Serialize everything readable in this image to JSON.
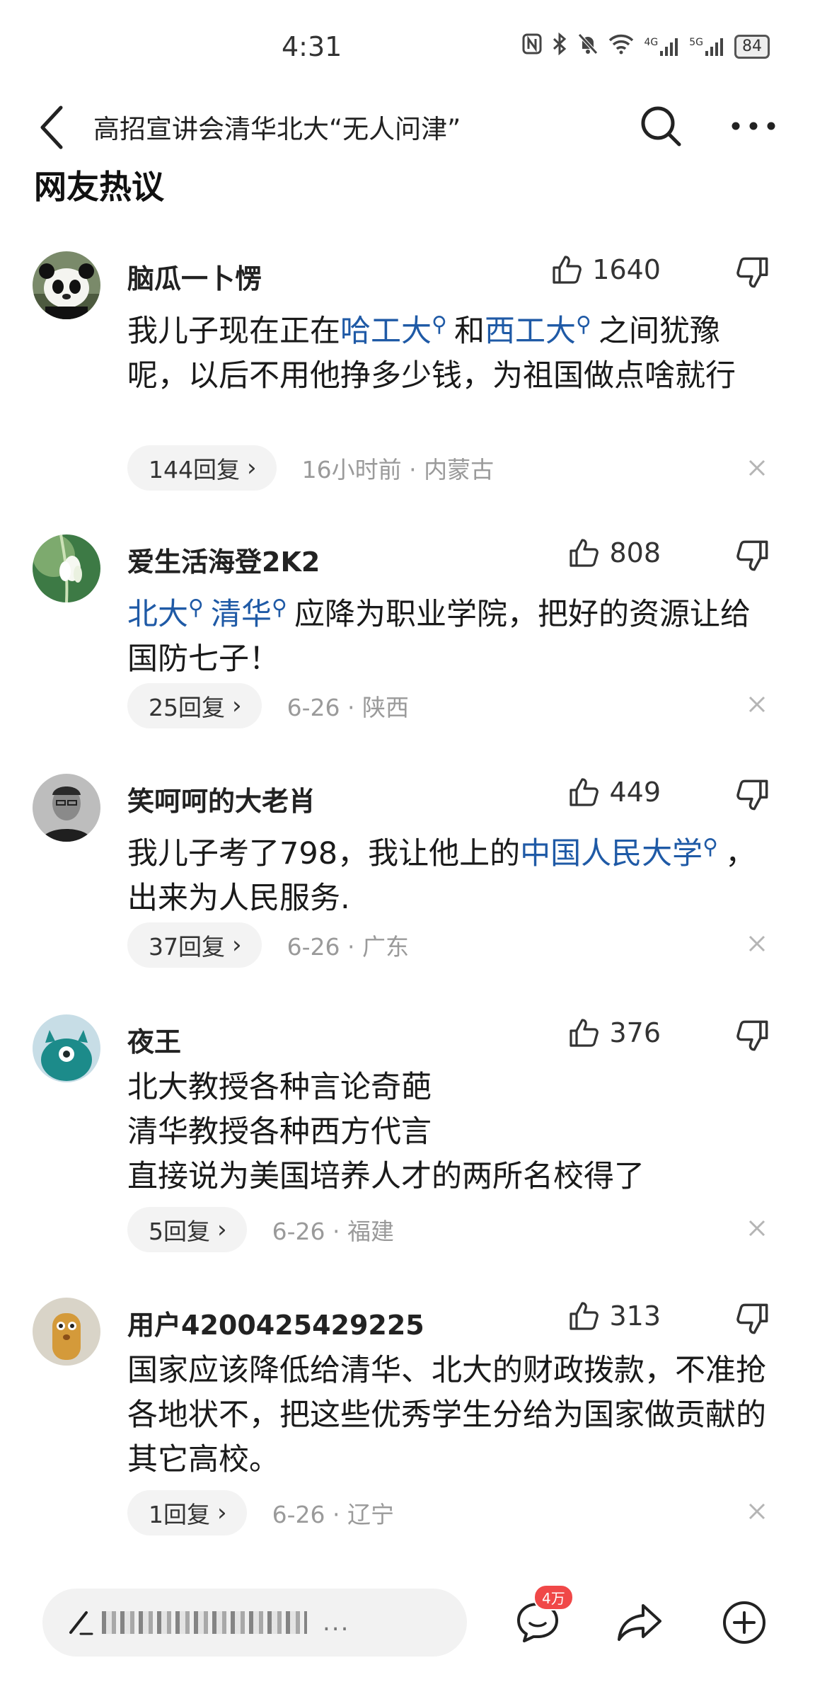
{
  "status_bar": {
    "time": "4:31",
    "battery": "84",
    "network_1": "4G",
    "network_2": "5G"
  },
  "nav": {
    "title": "高招宣讲会清华北大“无人问津”"
  },
  "section_title": "网友热议",
  "comments": [
    {
      "username": "脑瓜一卜愣",
      "likes": "1640",
      "text_parts": [
        "我儿子现在正在",
        "哈工大",
        "和",
        "西工大",
        "之间犹豫呢，以后不用他挣多少钱，为祖国做点啥就行"
      ],
      "replies": "144回复",
      "meta": "16小时前 · 内蒙古",
      "avatar": "panda"
    },
    {
      "username": "爱生活海登2K2",
      "likes": "808",
      "text_parts": [
        "北大",
        "清华",
        "应降为职业学院，把好的资源让给国防七子！"
      ],
      "replies": "25回复",
      "meta": "6-26 · 陕西",
      "avatar": "flower"
    },
    {
      "username": "笑呵呵的大老肖",
      "likes": "449",
      "text_parts": [
        "我儿子考了798，我让他上的",
        "中国人民大学",
        "，出来为人民服务."
      ],
      "replies": "37回复",
      "meta": "6-26 · 广东",
      "avatar": "person"
    },
    {
      "username": "夜王",
      "likes": "376",
      "text_lines": [
        "北大教授各种言论奇葩",
        "清华教授各种西方代言",
        "直接说为美国培养人才的两所名校得了"
      ],
      "replies": "5回复",
      "meta": "6-26 · 福建",
      "avatar": "monster"
    },
    {
      "username": "用户4200425429225",
      "likes": "313",
      "text": "国家应该降低给清华、北大的财政拨款，不准抢各地状不，把这些优秀学生分给为国家做贡献的其它高校。",
      "replies": "1回复",
      "meta": "6-26 · 辽宁",
      "avatar": "toy"
    }
  ],
  "bottom_bar": {
    "input_placeholder": "...",
    "comment_badge": "4万"
  },
  "colors": {
    "link": "#1f5aa6",
    "meta": "#9a9a9a",
    "badge": "#f04848"
  }
}
